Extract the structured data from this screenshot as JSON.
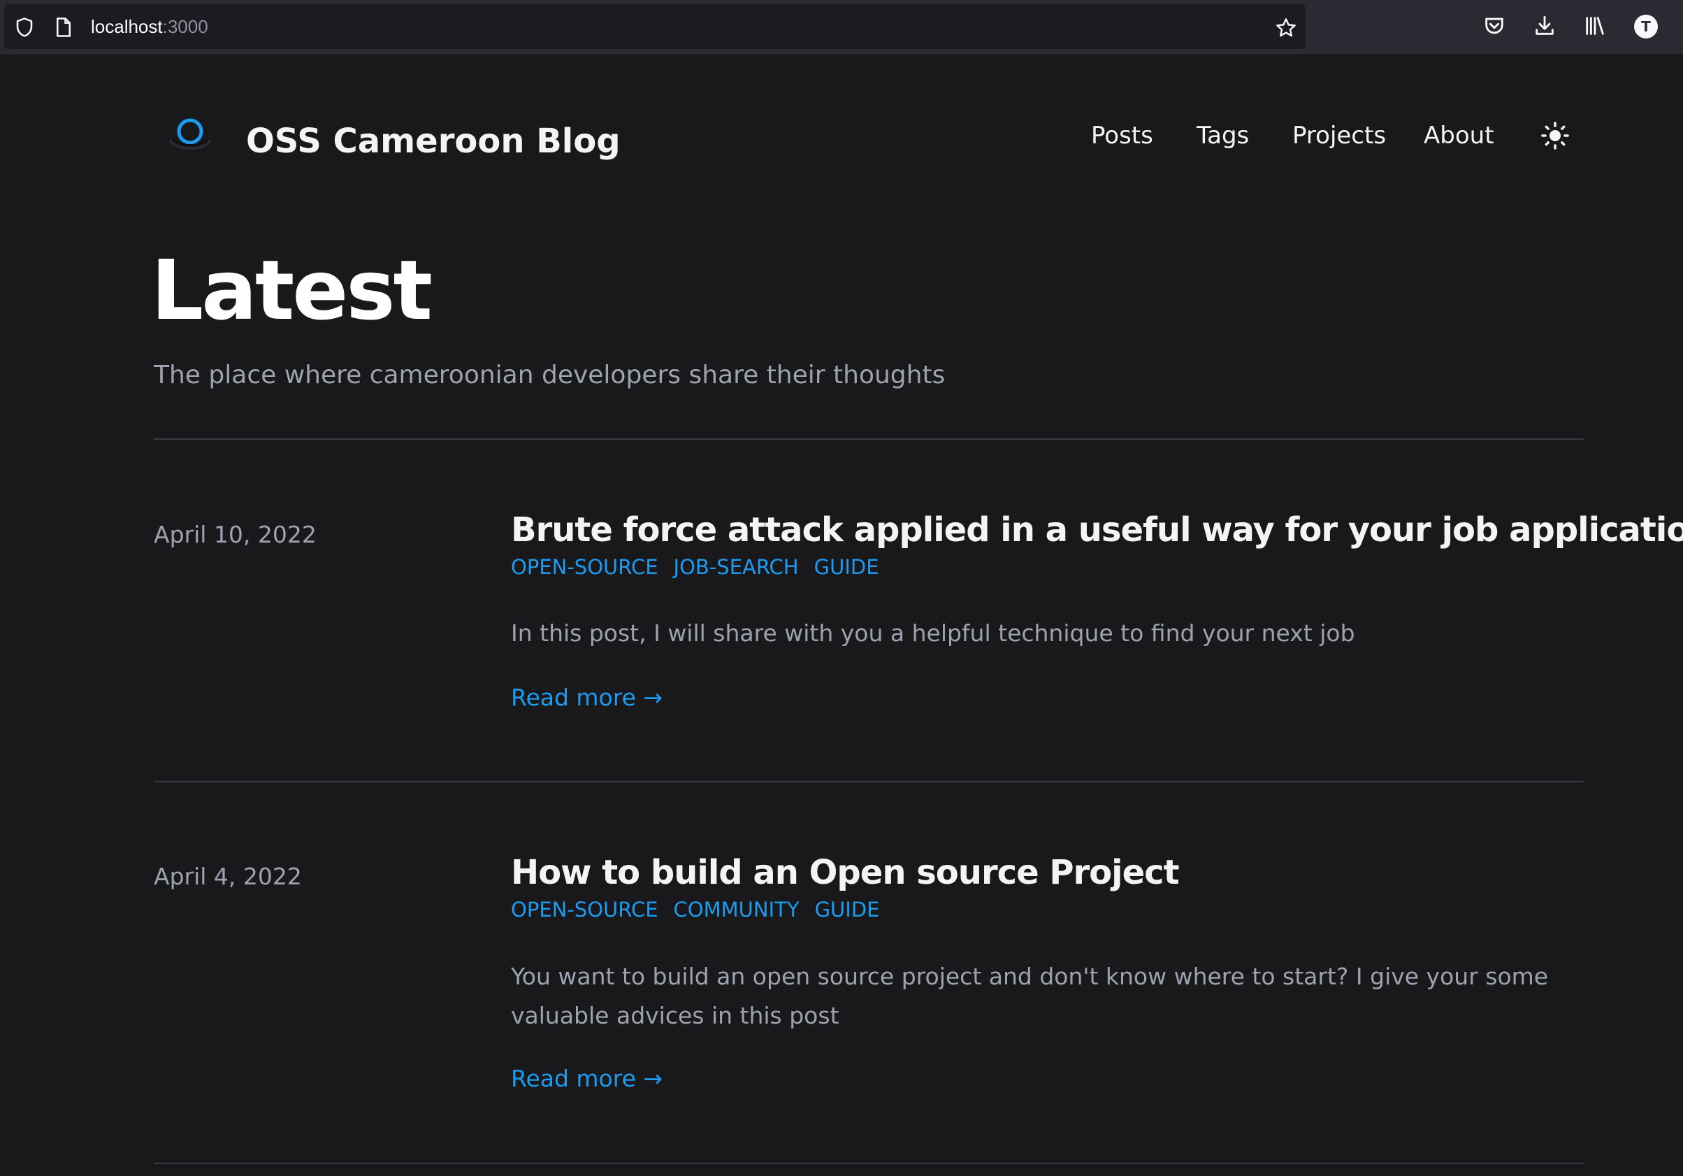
{
  "browser": {
    "url_host": "localhost",
    "url_port": ":3000",
    "avatar_initial": "T",
    "toolbar_icons": [
      "pocket-icon",
      "download-icon",
      "library-icon"
    ]
  },
  "site": {
    "title": "OSS Cameroon Blog",
    "nav": [
      "Posts",
      "Tags",
      "Projects",
      "About"
    ],
    "accent_color": "#1d9bf0",
    "background_color": "#19191b"
  },
  "page": {
    "heading": "Latest",
    "subtitle": "The place where cameroonian developers share their thoughts"
  },
  "posts": [
    {
      "date": "April 10, 2022",
      "title": "Brute force attack applied in a useful way for your job applications",
      "tags": [
        "OPEN-SOURCE",
        "JOB-SEARCH",
        "GUIDE"
      ],
      "summary": "In this post, I will share with you a helpful technique to find your next job",
      "read_more": "Read more →"
    },
    {
      "date": "April 4, 2022",
      "title": "How to build an Open source Project",
      "tags": [
        "OPEN-SOURCE",
        "COMMUNITY",
        "GUIDE"
      ],
      "summary": "You want to build an open source project and don't know where to start? I give your some valuable advices in this post",
      "read_more": "Read more →"
    }
  ]
}
